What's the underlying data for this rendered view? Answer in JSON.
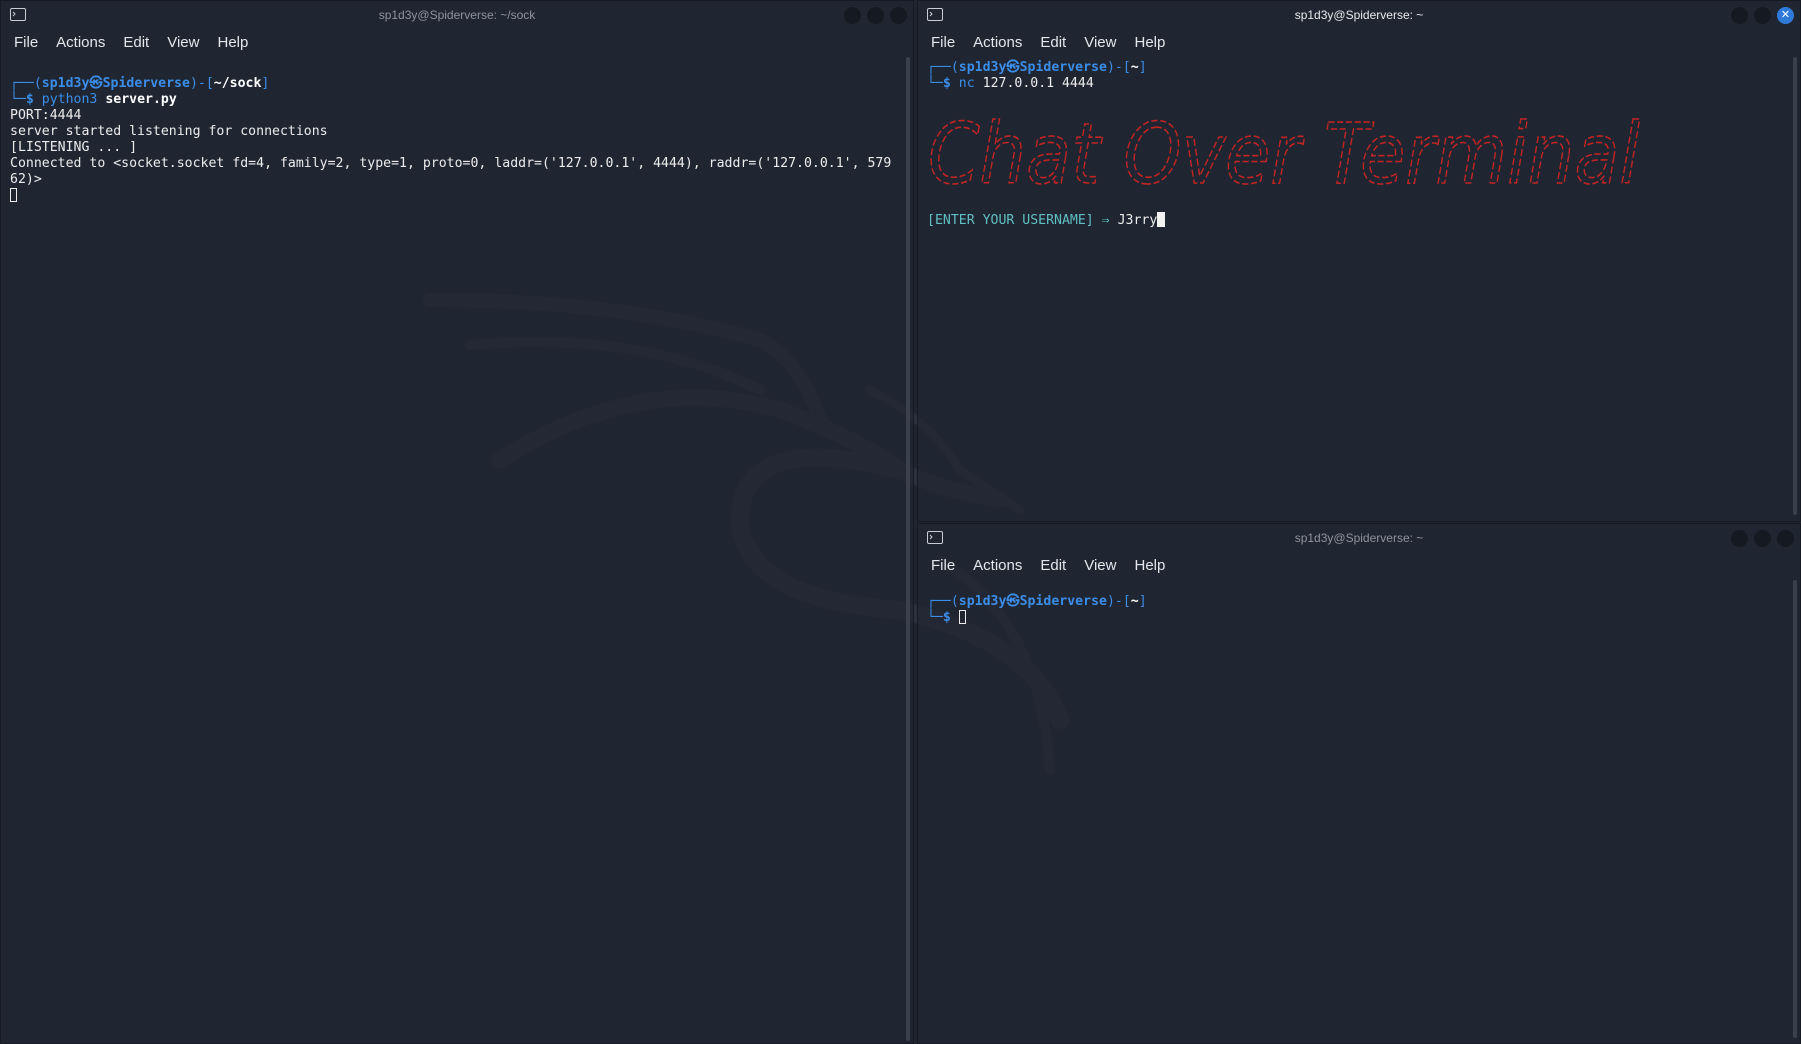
{
  "menu": [
    "File",
    "Actions",
    "Edit",
    "View",
    "Help"
  ],
  "prompt": {
    "user": "sp1d3y",
    "at": "㉿",
    "host": "Spiderverse",
    "sep": ")-[",
    "close": "]",
    "corner_top": "┌──(",
    "corner_bottom": "└─",
    "dollar": "$ "
  },
  "win_left": {
    "title": "sp1d3y@Spiderverse: ~/sock",
    "cwd": "~/sock",
    "command": "python3",
    "command_arg": "server.py",
    "output": [
      "PORT:4444",
      "server started listening for connections",
      "[LISTENING ... ]",
      "Connected to <socket.socket fd=4, family=2, type=1, proto=0, laddr=('127.0.0.1', 4444), raddr=('127.0.0.1', 579",
      "62)>"
    ]
  },
  "win_tr": {
    "title": "sp1d3y@Spiderverse: ~",
    "cwd": "~",
    "command": "nc",
    "command_arg": "127.0.0.1 4444",
    "banner": "Chat Over Terminal",
    "username_prompt": "[ENTER YOUR USERNAME] ⇒ ",
    "username_value": "J3rry"
  },
  "win_br": {
    "title": "sp1d3y@Spiderverse: ~",
    "cwd": "~"
  },
  "colors": {
    "prompt_blue": "#3a8de8",
    "banner_red": "#c22424",
    "input_cyan": "#5fbfc3",
    "active_close": "#2f7ad9"
  }
}
